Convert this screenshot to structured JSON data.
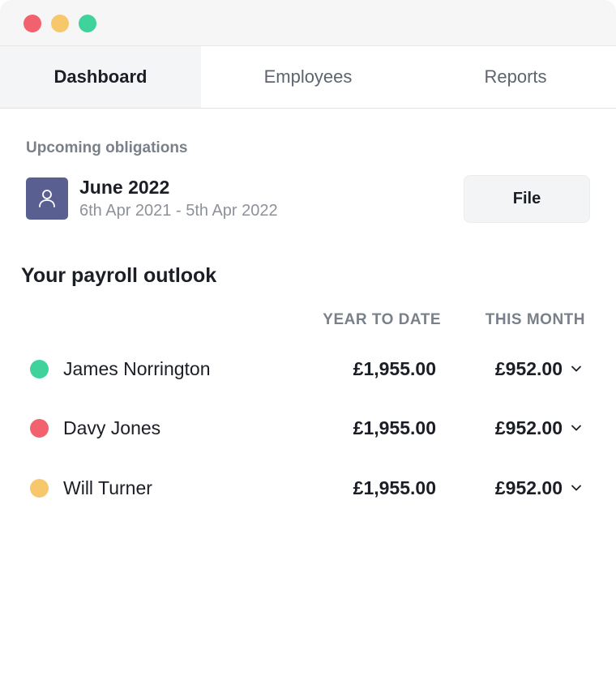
{
  "window": {
    "traffic_lights": {
      "close_color": "#f2616e",
      "minimize_color": "#f7c86b",
      "maximize_color": "#3fd29b"
    }
  },
  "tabs": [
    {
      "label": "Dashboard",
      "active": true
    },
    {
      "label": "Employees",
      "active": false
    },
    {
      "label": "Reports",
      "active": false
    }
  ],
  "obligations": {
    "section_label": "Upcoming obligations",
    "item": {
      "icon": "user-icon",
      "icon_bg_color": "#5a5f91",
      "title": "June 2022",
      "date_range": "6th Apr 2021 - 5th Apr 2022",
      "action_label": "File"
    }
  },
  "outlook": {
    "heading": "Your payroll outlook",
    "columns": {
      "year_to_date": "YEAR TO DATE",
      "this_month": "THIS MONTH"
    },
    "rows": [
      {
        "name": "James Norrington",
        "dot_color": "#3fd29b",
        "year_to_date": "£1,955.00",
        "this_month": "£952.00",
        "icon": "chevron-down-icon"
      },
      {
        "name": "Davy Jones",
        "dot_color": "#f2616e",
        "year_to_date": "£1,955.00",
        "this_month": "£952.00",
        "icon": "chevron-down-icon"
      },
      {
        "name": "Will Turner",
        "dot_color": "#f7c86b",
        "year_to_date": "£1,955.00",
        "this_month": "£952.00",
        "icon": "chevron-down-icon"
      }
    ]
  }
}
